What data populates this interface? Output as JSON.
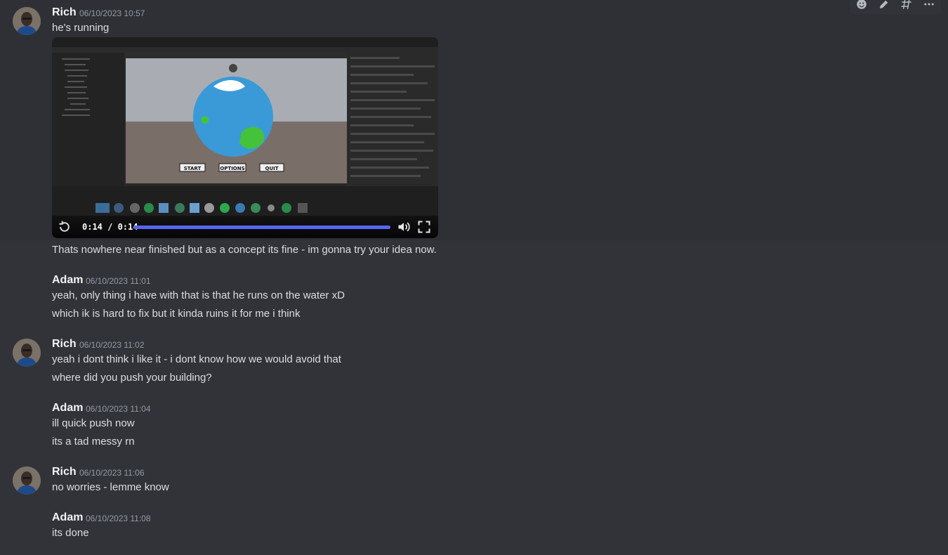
{
  "colors": {
    "accent": "#5865f2",
    "background": "#313338",
    "hover": "#2e3035"
  },
  "toolbar_icons": [
    "add-reaction-icon",
    "edit-icon",
    "create-thread-icon",
    "more-options-icon"
  ],
  "messages": [
    {
      "author": "Rich",
      "timestamp": "06/10/2023 10:57",
      "lines": [
        "he's running"
      ]
    },
    {
      "author": "Adam",
      "timestamp": "06/10/2023 11:01",
      "lines": [
        "yeah, only thing i have with that is that he runs on the water xD",
        "which ik is hard to fix but it kinda ruins it for me i think"
      ]
    },
    {
      "author": "Rich",
      "timestamp": "06/10/2023 11:02",
      "lines": [
        "yeah i dont think i like it - i dont know how we would avoid that",
        "where did you push your building?"
      ]
    },
    {
      "author": "Adam",
      "timestamp": "06/10/2023 11:04",
      "lines": [
        "ill quick push now",
        "its a tad messy rn"
      ]
    },
    {
      "author": "Rich",
      "timestamp": "06/10/2023 11:06",
      "lines": [
        "no worries - lemme know"
      ]
    },
    {
      "author": "Adam",
      "timestamp": "06/10/2023 11:08",
      "lines": [
        "its done"
      ]
    }
  ],
  "followup_line": "Thats nowhere near finished but as a concept its fine - im gonna try your idea now.",
  "video": {
    "time": "0:14 / 0:14",
    "progress": 1.0,
    "game_buttons": [
      "START",
      "OPTIONS",
      "QUIT"
    ]
  }
}
